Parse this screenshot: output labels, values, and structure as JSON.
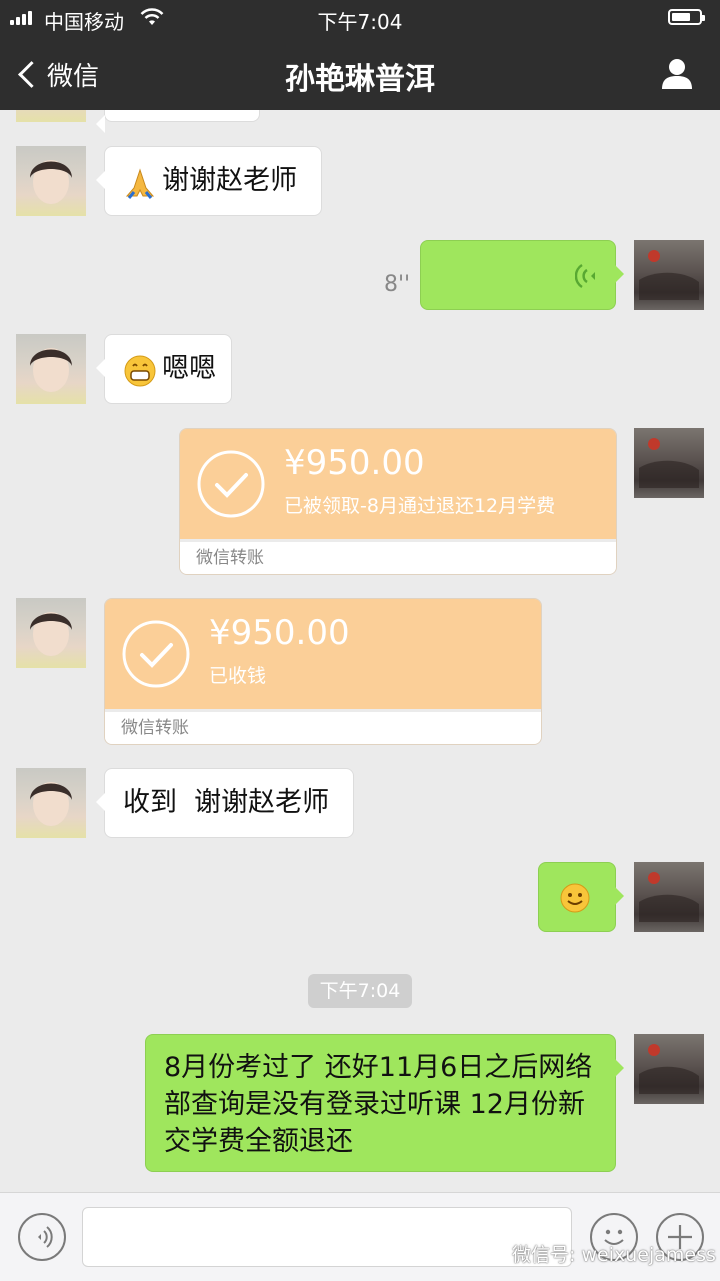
{
  "status": {
    "carrier": "中国移动",
    "time": "下午7:04"
  },
  "nav": {
    "back_label": "微信",
    "title": "孙艳琳普洱"
  },
  "messages": {
    "thanks": "谢谢赵老师",
    "voice_duration": "8''",
    "enen": "嗯嗯",
    "transfer_sent": {
      "amount": "¥950.00",
      "status": "已被领取-8月通过退还12月学费",
      "footer": "微信转账"
    },
    "transfer_received": {
      "amount": "¥950.00",
      "status": "已收钱",
      "footer": "微信转账"
    },
    "received_reply": "收到  谢谢赵老师",
    "timestamp": "下午7:04",
    "last_message": "8月份考过了 还好11月6日之后网络部查询是没有登录过听课 12月份新交学费全额退还"
  },
  "watermark": "微信号: weixuejamess",
  "colors": {
    "bar_bg": "#2e2e2e",
    "chat_bg": "#ebebeb",
    "green_bubble": "#9fe65d",
    "transfer_orange": "#fbcf98"
  },
  "icons": [
    "signal-icon",
    "wifi-icon",
    "battery-icon",
    "back-chevron-icon",
    "profile-icon",
    "folded-hands-emoji",
    "grinning-emoji",
    "voice-wave-icon",
    "check-circle-icon",
    "smile-emoji",
    "voice-input-icon",
    "emoji-face-icon",
    "plus-icon"
  ]
}
